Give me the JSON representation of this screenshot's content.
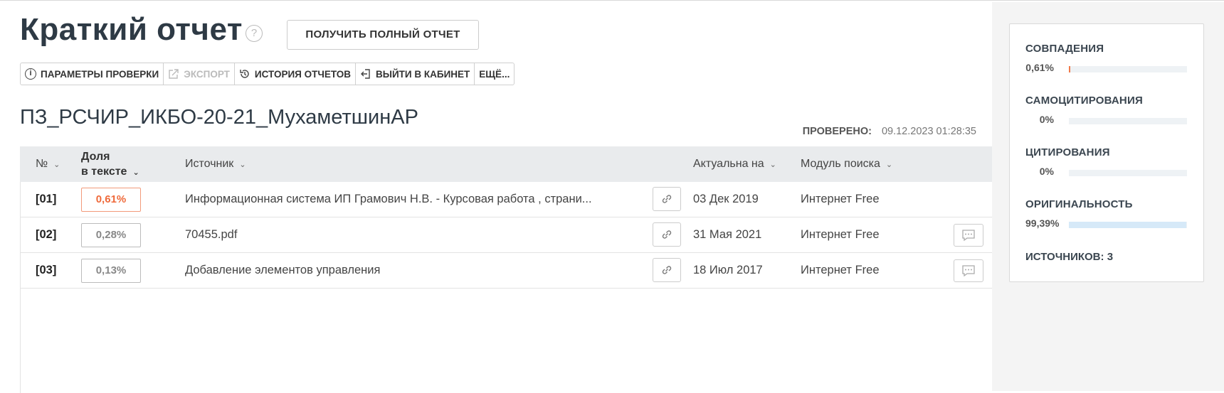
{
  "header": {
    "title": "Краткий отчет",
    "help": "?",
    "full_report_button": "ПОЛУЧИТЬ ПОЛНЫЙ ОТЧЕТ"
  },
  "toolbar": {
    "params": "ПАРАМЕТРЫ ПРОВЕРКИ",
    "export": "ЭКСПОРТ",
    "history": "ИСТОРИЯ ОТЧЕТОВ",
    "exit": "ВЫЙТИ В КАБИНЕТ",
    "more": "ЕЩЁ..."
  },
  "document": {
    "name": "ПЗ_РСЧИР_ИКБО-20-21_МухаметшинАР",
    "checked_label": "ПРОВЕРЕНО:",
    "checked_date": "09.12.2023 01:28:35"
  },
  "table": {
    "headers": {
      "num": "№",
      "share_line1": "Доля",
      "share_line2": "в тексте",
      "source": "Источник",
      "actual": "Актуальна на",
      "module": "Модуль поиска"
    },
    "rows": [
      {
        "num": "[01]",
        "share": "0,61%",
        "source": "Информационная система ИП Грамович Н.В. - Курсовая работа , страни...",
        "date": "03 Дек 2019",
        "module": "Интернет Free",
        "comment": false
      },
      {
        "num": "[02]",
        "share": "0,28%",
        "source": "70455.pdf",
        "date": "31 Мая 2021",
        "module": "Интернет Free",
        "comment": true
      },
      {
        "num": "[03]",
        "share": "0,13%",
        "source": "Добавление элементов управления",
        "date": "18 Июл 2017",
        "module": "Интернет Free",
        "comment": true
      }
    ]
  },
  "summary": {
    "matches": {
      "label": "СОВПАДЕНИЯ",
      "value": "0,61%",
      "fraction": 0.0061,
      "color": "#f07a4a"
    },
    "self_citations": {
      "label": "САМОЦИТИРОВАНИЯ",
      "value": "0%",
      "fraction": 0,
      "color": "#f07a4a"
    },
    "citations": {
      "label": "ЦИТИРОВАНИЯ",
      "value": "0%",
      "fraction": 0,
      "color": "#4caf50"
    },
    "originality": {
      "label": "ОРИГИНАЛЬНОСТЬ",
      "value": "99,39%",
      "fraction": 0.9939,
      "color": "#d6e9f8"
    },
    "sources_label": "ИСТОЧНИКОВ:",
    "sources_count": "3"
  }
}
